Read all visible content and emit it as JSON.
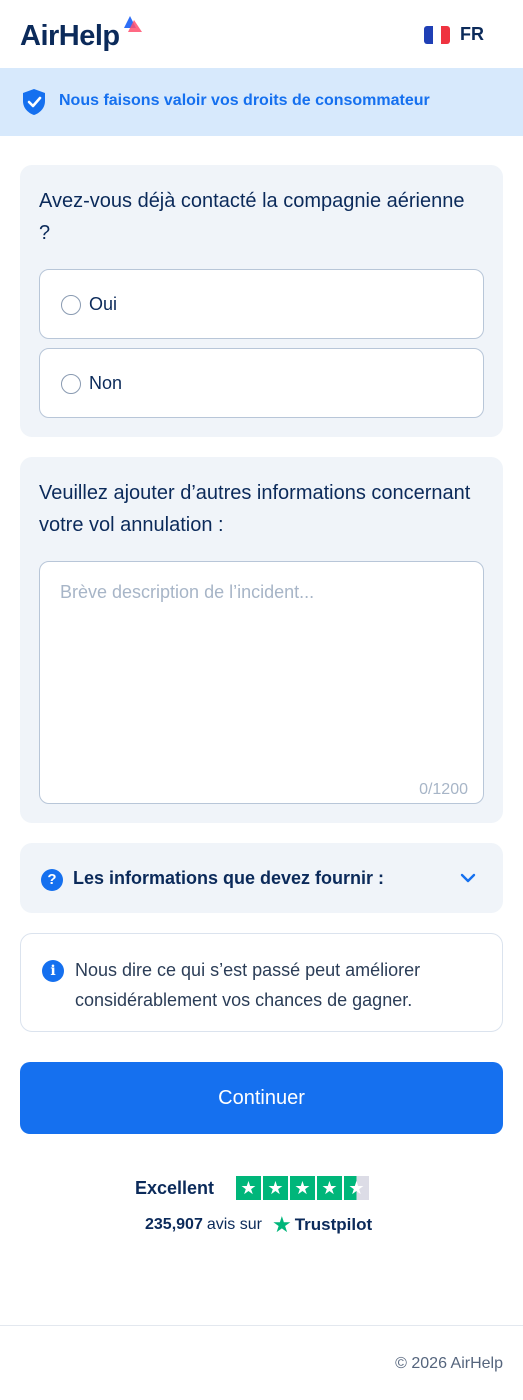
{
  "header": {
    "logo_text": "AirHelp",
    "language": "FR"
  },
  "banner": {
    "text": "Nous faisons valoir vos droits de consommateur"
  },
  "question_contact": {
    "title": "Avez-vous déjà contacté la compagnie aérienne ?",
    "options": [
      {
        "label": "Oui",
        "selected": false
      },
      {
        "label": "Non",
        "selected": false
      }
    ]
  },
  "question_details": {
    "title": "Veuillez ajouter d’autres informations concernant votre vol annulation :",
    "placeholder": "Brève description de l’incident...",
    "value": "",
    "counter": "0/1200"
  },
  "accordion": {
    "label": "Les informations que devez fournir :"
  },
  "info": {
    "text": "Nous dire ce qui s’est passé peut améliorer considérablement vos chances de gagner."
  },
  "continue_button": {
    "label": "Continuer"
  },
  "trustpilot": {
    "rating_label": "Excellent",
    "stars": 4.5,
    "review_count": "235,907",
    "reviews_text": "avis sur",
    "brand": "Trustpilot"
  },
  "footer": {
    "copyright": "© 2026 AirHelp"
  },
  "colors": {
    "primary": "#1570ef",
    "navy": "#0b2a5a",
    "banner_bg": "#d7e9fc",
    "card_bg": "#f0f4f9",
    "trustpilot_green": "#00b67a"
  },
  "icons": {
    "banner": "shield-check-icon",
    "accordion": "question-circle-icon",
    "accordion_toggle": "chevron-down-icon",
    "info": "info-circle-icon",
    "trustpilot": "star-icon"
  }
}
